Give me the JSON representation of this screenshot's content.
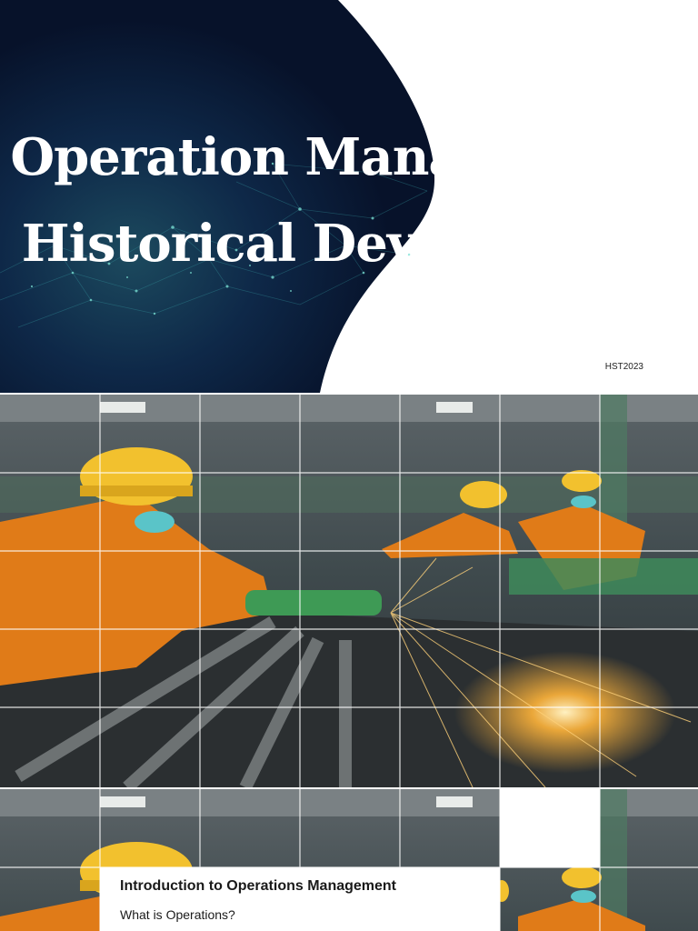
{
  "slide_title": {
    "line1": "Operation Management:",
    "line2": "Historical Development",
    "code": "HST2023"
  },
  "photo": {
    "description_icon": "industrial-workers-grinding-photo"
  },
  "intro_slide": {
    "title": "Introduction to Operations Management",
    "subtitle": "What is Operations?"
  },
  "colors": {
    "navy": "#0b1730",
    "helmet": "#f2c12e",
    "uniform": "#e07b18",
    "sparks": "#ffb43a"
  }
}
